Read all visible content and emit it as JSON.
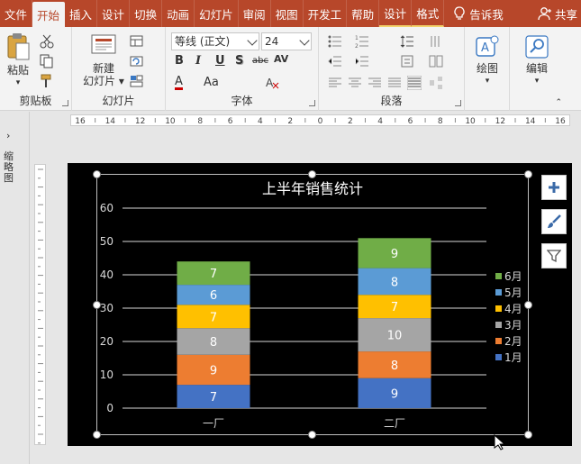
{
  "tabs": [
    {
      "label": "文件",
      "active": false
    },
    {
      "label": "开始",
      "active": true
    },
    {
      "label": "插入",
      "active": false
    },
    {
      "label": "设计",
      "active": false
    },
    {
      "label": "切换",
      "active": false
    },
    {
      "label": "动画",
      "active": false
    },
    {
      "label": "幻灯片",
      "active": false
    },
    {
      "label": "审阅",
      "active": false
    },
    {
      "label": "视图",
      "active": false
    },
    {
      "label": "开发工",
      "active": false
    },
    {
      "label": "帮助",
      "active": false
    },
    {
      "label": "设计",
      "active": false
    },
    {
      "label": "格式",
      "active": false
    }
  ],
  "tell_me": "告诉我",
  "share": "共享",
  "ribbon": {
    "clipboard": {
      "paste": "粘贴",
      "label": "剪贴板"
    },
    "slides": {
      "new_slide_line1": "新建",
      "new_slide_line2": "幻灯片",
      "label": "幻灯片"
    },
    "font": {
      "font_name": "等线 (正文)",
      "font_size": "24",
      "label": "字体",
      "bold": "B",
      "italic": "I",
      "underline": "U",
      "shadow": "S",
      "strike": "abc",
      "spacing": "AV",
      "color": "A",
      "case": "Aa"
    },
    "paragraph": {
      "label": "段落"
    },
    "drawing": {
      "label": "绘图"
    },
    "editing": {
      "label": "编辑"
    }
  },
  "thumbnails_label": "缩略图",
  "ruler_labels": [
    "16",
    "14",
    "12",
    "10",
    "8",
    "6",
    "4",
    "2",
    "0",
    "2",
    "4",
    "6",
    "8",
    "10",
    "12",
    "14",
    "16"
  ],
  "colors": {
    "accent": "#b7472a"
  },
  "side_buttons": [
    "plus-icon",
    "brush-icon",
    "filter-icon"
  ],
  "chart_data": {
    "type": "bar",
    "stacked": true,
    "title": "上半年销售统计",
    "categories": [
      "一厂",
      "二厂"
    ],
    "ylim": [
      0,
      60
    ],
    "yticks": [
      0,
      10,
      20,
      30,
      40,
      50,
      60
    ],
    "grid": true,
    "legend_position": "right",
    "series": [
      {
        "name": "1月",
        "color": "#4472c4",
        "values": [
          7,
          9
        ]
      },
      {
        "name": "2月",
        "color": "#ed7d31",
        "values": [
          9,
          8
        ]
      },
      {
        "name": "3月",
        "color": "#a5a5a5",
        "values": [
          8,
          10
        ]
      },
      {
        "name": "4月",
        "color": "#ffc000",
        "values": [
          7,
          7
        ]
      },
      {
        "name": "5月",
        "color": "#5b9bd5",
        "values": [
          6,
          8
        ]
      },
      {
        "name": "6月",
        "color": "#70ad47",
        "values": [
          7,
          9
        ]
      }
    ]
  }
}
